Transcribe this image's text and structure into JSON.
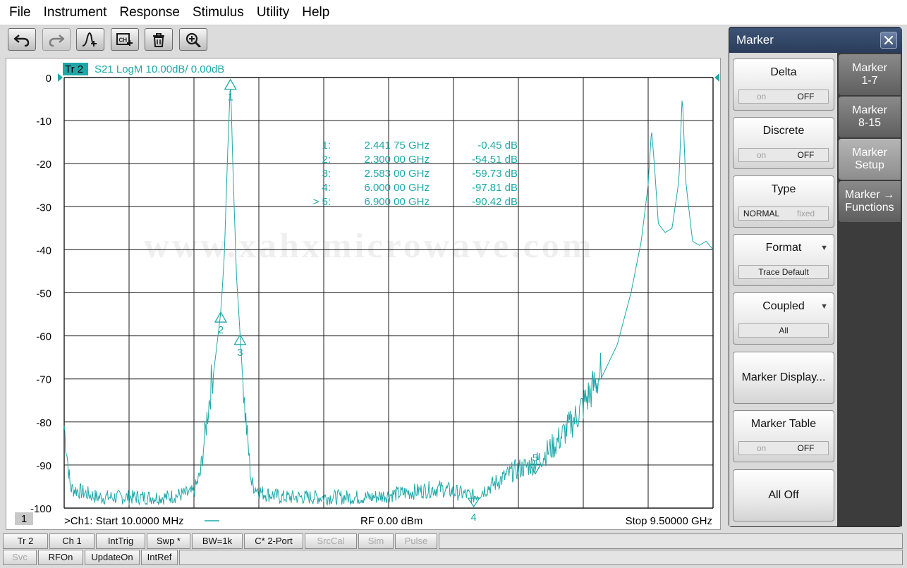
{
  "menu": [
    "File",
    "Instrument",
    "Response",
    "Stimulus",
    "Utility",
    "Help"
  ],
  "toolbar": {
    "buttons": [
      {
        "name": "undo-button",
        "icon": "undo-icon",
        "enabled": true
      },
      {
        "name": "redo-button",
        "icon": "redo-icon",
        "enabled": false
      },
      {
        "name": "add-marker-button",
        "icon": "marker-add-icon",
        "enabled": true
      },
      {
        "name": "add-channel-button",
        "icon": "channel-add-icon",
        "enabled": true
      },
      {
        "name": "delete-button",
        "icon": "trash-icon",
        "enabled": true
      },
      {
        "name": "zoom-button",
        "icon": "zoom-in-icon",
        "enabled": true
      }
    ]
  },
  "trace": {
    "label": "Tr 2",
    "info": "S21 LogM 10.00dB/  0.00dB",
    "color": "#1fa8a8"
  },
  "watermark": "www.xahxmicrowave.com",
  "window_number": "1",
  "footer": {
    "start": ">Ch1:  Start   10.0000 MHz",
    "rf": "RF    0.00 dBm",
    "stop": "Stop  9.50000 GHz"
  },
  "marker_table": [
    {
      "id": "1:",
      "freq": "2.441 75 GHz",
      "value": "-0.45 dB",
      "active": false
    },
    {
      "id": "2:",
      "freq": "2.300 00 GHz",
      "value": "-54.51 dB",
      "active": false
    },
    {
      "id": "3:",
      "freq": "2.583 00 GHz",
      "value": "-59.73 dB",
      "active": false
    },
    {
      "id": "4:",
      "freq": "6.000 00 GHz",
      "value": "-97.81 dB",
      "active": false
    },
    {
      "id": "> 5:",
      "freq": "6.900 00 GHz",
      "value": "-90.42 dB",
      "active": true
    }
  ],
  "chart_data": {
    "type": "line",
    "xlabel": "",
    "ylabel": "",
    "xlim": [
      0.01,
      9.5
    ],
    "ylim": [
      -100,
      0
    ],
    "x_unit": "GHz",
    "y_unit": "dB",
    "y_ticks": [
      0,
      -10,
      -20,
      -30,
      -40,
      -50,
      -60,
      -70,
      -80,
      -90,
      -100
    ],
    "grid": true,
    "series": [
      {
        "x": [
          0.01,
          0.1,
          0.5,
          1.0,
          1.5,
          1.9,
          2.0,
          2.1,
          2.2,
          2.3,
          2.35,
          2.4,
          2.44175,
          2.48,
          2.53,
          2.583,
          2.65,
          2.75,
          2.9,
          3.2,
          3.5,
          4.0,
          4.5,
          5.0,
          5.5,
          6.0,
          6.3,
          6.6,
          6.9,
          7.2,
          7.5,
          7.8,
          8.1,
          8.3,
          8.45,
          8.55,
          8.6,
          8.65,
          8.7,
          8.8,
          8.9,
          9.0,
          9.05,
          9.1,
          9.2,
          9.3,
          9.4,
          9.5
        ],
        "y": [
          -82,
          -96,
          -98,
          -98,
          -98,
          -97,
          -93,
          -80,
          -68,
          -54.51,
          -42,
          -18,
          -0.45,
          -22,
          -46,
          -59.73,
          -78,
          -95,
          -97,
          -98,
          -98,
          -98,
          -98,
          -97,
          -96,
          -97.81,
          -95,
          -92,
          -90.42,
          -86,
          -80,
          -72,
          -62,
          -50,
          -38,
          -25,
          -12,
          -22,
          -34,
          -36,
          -35,
          -24,
          -4,
          -24,
          -38,
          -39,
          -38,
          -40
        ]
      }
    ],
    "markers": [
      {
        "label": "1",
        "x": 2.44175,
        "y": -0.45
      },
      {
        "label": "2",
        "x": 2.3,
        "y": -54.51
      },
      {
        "label": "3",
        "x": 2.583,
        "y": -59.73
      },
      {
        "label": "4",
        "x": 6.0,
        "y": -97.81
      },
      {
        "label": "5",
        "x": 6.9,
        "y": -90.42
      }
    ]
  },
  "marker_panel": {
    "title": "Marker",
    "softkeys": [
      {
        "name": "delta-softkey",
        "label": "Delta",
        "options": [
          "on",
          "OFF"
        ],
        "selected": 1
      },
      {
        "name": "discrete-softkey",
        "label": "Discrete",
        "options": [
          "on",
          "OFF"
        ],
        "selected": 1
      },
      {
        "name": "type-softkey",
        "label": "Type",
        "options": [
          "NORMAL",
          "fixed"
        ],
        "selected": 0
      },
      {
        "name": "format-softkey",
        "label": "Format",
        "value": "Trace Default",
        "dropdown": true
      },
      {
        "name": "coupled-softkey",
        "label": "Coupled",
        "value": "All",
        "dropdown": true
      },
      {
        "name": "marker-display-softkey",
        "label": "Marker Display..."
      },
      {
        "name": "marker-table-softkey",
        "label": "Marker Table",
        "options": [
          "on",
          "OFF"
        ],
        "selected": 1
      },
      {
        "name": "all-off-softkey",
        "label": "All Off"
      }
    ],
    "tabs": [
      {
        "name": "tab-marker-1-7",
        "line1": "Marker",
        "line2": "1-7",
        "active": false
      },
      {
        "name": "tab-marker-8-15",
        "line1": "Marker",
        "line2": "8-15",
        "active": false
      },
      {
        "name": "tab-marker-setup",
        "line1": "Marker",
        "line2": "Setup",
        "active": true
      },
      {
        "name": "tab-marker-functions",
        "line1": "Marker →",
        "line2": "Functions",
        "active": false
      }
    ]
  },
  "status_bar": {
    "row1": [
      {
        "label": "Tr 2",
        "enabled": true
      },
      {
        "label": "Ch 1",
        "enabled": true
      },
      {
        "label": "IntTrig",
        "enabled": true
      },
      {
        "label": "Swp *",
        "enabled": true
      },
      {
        "label": "BW=1k",
        "enabled": true
      },
      {
        "label": "C* 2-Port",
        "enabled": true
      },
      {
        "label": "SrcCal",
        "enabled": false
      },
      {
        "label": "Sim",
        "enabled": false
      },
      {
        "label": "Pulse",
        "enabled": false
      }
    ],
    "row2": [
      {
        "label": "Svc",
        "enabled": false
      },
      {
        "label": "RFOn",
        "enabled": true
      },
      {
        "label": "UpdateOn",
        "enabled": true
      },
      {
        "label": "IntRef",
        "enabled": true
      }
    ]
  }
}
